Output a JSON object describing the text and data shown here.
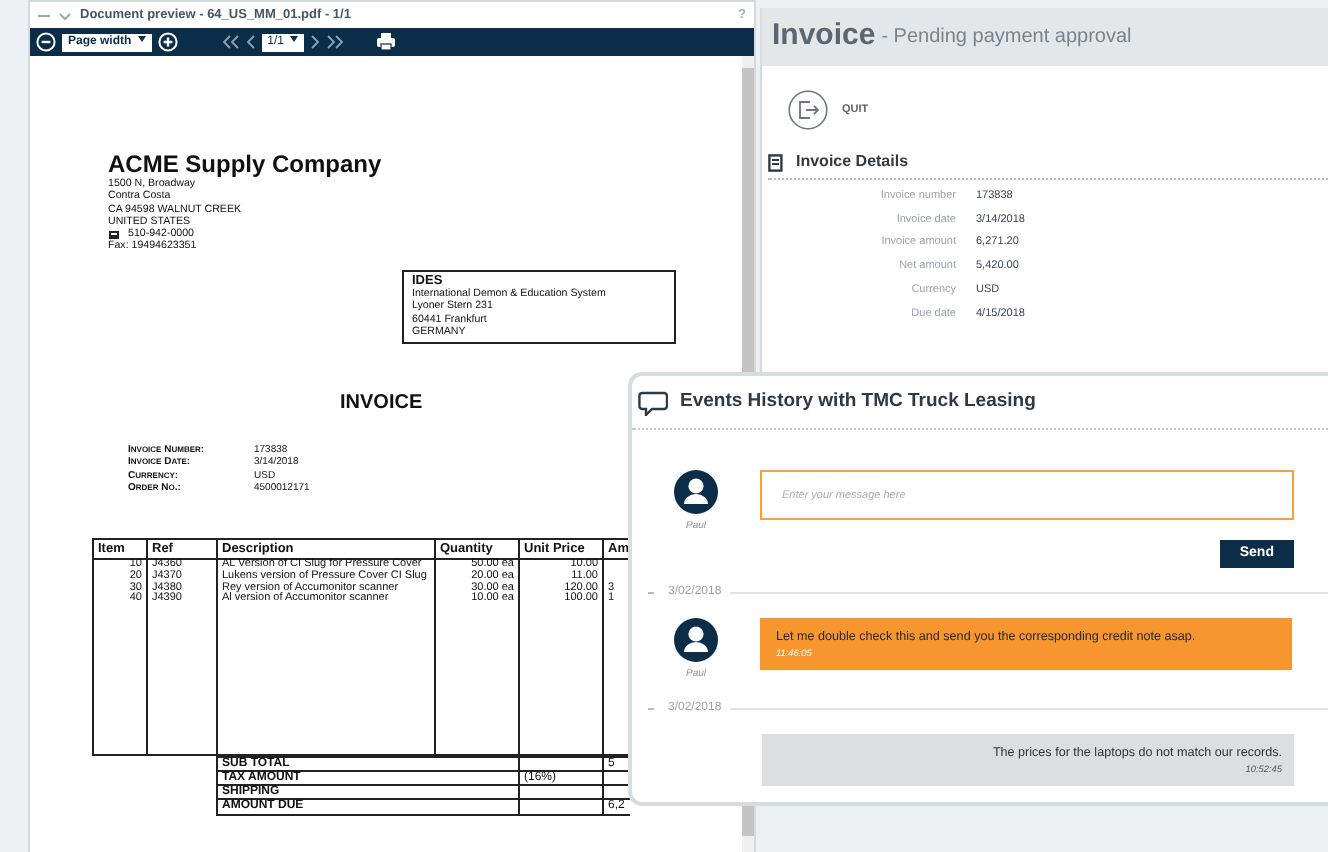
{
  "preview": {
    "title": "Document preview - 64_US_MM_01.pdf - 1/1",
    "help": "?",
    "zoom": "Page width",
    "page": "1/1",
    "document": {
      "company": "ACME Supply Company",
      "address": [
        "1500 N, Broadway",
        "Contra Costa",
        "CA 94598 WALNUT CREEK",
        "UNITED STATES"
      ],
      "phone": "510-942-0000",
      "fax": "Fax: 19494623351",
      "recipient": {
        "name": "IDES",
        "lines": [
          "International Demon & Education System",
          "Lyoner Stern 231",
          "60441 Frankfurt",
          "GERMANY"
        ]
      },
      "heading": "INVOICE",
      "meta": [
        {
          "label": "Invoice Number:",
          "value": "173838"
        },
        {
          "label": "Invoice Date:",
          "value": "3/14/2018"
        },
        {
          "label": "Currency:",
          "value": "USD"
        },
        {
          "label": "Order No.:",
          "value": "4500012171"
        }
      ],
      "columns": [
        "Item",
        "Ref",
        "Description",
        "Quantity",
        "Unit Price",
        "Am"
      ],
      "rows": [
        {
          "item": "10",
          "ref": "J4360",
          "description": "AL Version of CI Slug for Pressure Cover",
          "quantity": "50.00 ea",
          "unit_price": "10.00"
        },
        {
          "item": "20",
          "ref": "J4370",
          "description": "Lukens version of Pressure Cover CI Slug",
          "quantity": "20.00 ea",
          "unit_price": "11.00"
        },
        {
          "item": "30",
          "ref": "J4380",
          "description": "Rey version of Accumonitor scanner",
          "quantity": "30.00 ea",
          "unit_price": "120.00",
          "amount": "3"
        },
        {
          "item": "40",
          "ref": "J4390",
          "description": "Al version of Accumonitor scanner",
          "quantity": "10.00 ea",
          "unit_price": "100.00",
          "amount": "1"
        }
      ],
      "totals": [
        {
          "label": "SUB TOTAL",
          "amount": "5"
        },
        {
          "label": "TAX AMOUNT",
          "note": "(16%)"
        },
        {
          "label": "SHIPPING"
        },
        {
          "label": "AMOUNT DUE",
          "amount": "6,2"
        }
      ]
    }
  },
  "invoice": {
    "title": "Invoice",
    "subtitle": "- Pending payment approval",
    "quit": "QUIT",
    "section": "Invoice Details",
    "fields": [
      {
        "label": "Invoice number",
        "value": "173838"
      },
      {
        "label": "Invoice date",
        "value": "3/14/2018"
      },
      {
        "label": "Invoice amount",
        "value": "6,271.20"
      },
      {
        "label": "Net amount",
        "value": "5,420.00"
      },
      {
        "label": "Currency",
        "value": "USD"
      },
      {
        "label": "Due date",
        "value": "4/15/2018"
      }
    ]
  },
  "chat": {
    "title": "Events History with TMC Truck Leasing",
    "composer": {
      "author": "Paul",
      "placeholder": "Enter your message here",
      "send": "Send"
    },
    "events": [
      {
        "date": "3/02/2018",
        "kind": "own",
        "author": "Paul",
        "text": "Let me double check this and send you the corresponding credit note asap.",
        "time": "11:46:05"
      },
      {
        "date": "3/02/2018",
        "kind": "partner",
        "text": "The prices for the laptops do not match our records.",
        "time": "10:52:45"
      }
    ]
  }
}
